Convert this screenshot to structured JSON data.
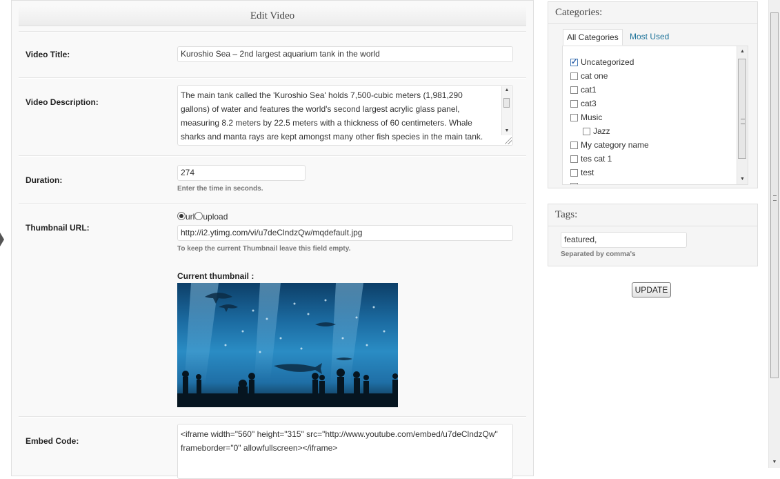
{
  "form": {
    "title": "Edit Video",
    "video_title": {
      "label": "Video Title:",
      "value": "Kuroshio Sea – 2nd largest aquarium tank in the world"
    },
    "video_description": {
      "label": "Video Description:",
      "lines": [
        "The main tank called the 'Kuroshio Sea' holds 7,500-cubic meters (1,981,290",
        "gallons) of water and features the world's second largest acrylic glass panel,",
        "measuring 8.2 meters by 22.5 meters with a thickness of 60 centimeters. Whale",
        "sharks and manta rays are kept amongst many other fish species in the main tank."
      ]
    },
    "duration": {
      "label": "Duration:",
      "value": "274",
      "hint": "Enter the time in seconds."
    },
    "thumbnail": {
      "label": "Thumbnail URL:",
      "options": [
        "url",
        "upload"
      ],
      "selected": "url",
      "value": "http://i2.ytimg.com/vi/u7deClndzQw/mqdefault.jpg",
      "hint": "To keep the current Thumbnail leave this field empty.",
      "current_label": "Current thumbnail :"
    },
    "embed_code": {
      "label": "Embed Code:",
      "lines": [
        "<iframe width=\"560\" height=\"315\" src=\"http://www.youtube.com/embed/u7deClndzQw\"",
        "frameborder=\"0\" allowfullscreen></iframe>"
      ]
    }
  },
  "categories": {
    "title": "Categories:",
    "tabs": [
      "All Categories",
      "Most Used"
    ],
    "items": [
      {
        "label": "Uncategorized",
        "checked": true,
        "child": false
      },
      {
        "label": "cat one",
        "checked": false,
        "child": false
      },
      {
        "label": "cat1",
        "checked": false,
        "child": false
      },
      {
        "label": "cat3",
        "checked": false,
        "child": false
      },
      {
        "label": "Music",
        "checked": false,
        "child": false
      },
      {
        "label": "Jazz",
        "checked": false,
        "child": true
      },
      {
        "label": "My category name",
        "checked": false,
        "child": false
      },
      {
        "label": "tes cat 1",
        "checked": false,
        "child": false
      },
      {
        "label": "test",
        "checked": false,
        "child": false
      }
    ]
  },
  "tags": {
    "title": "Tags:",
    "value": "featured,",
    "hint": "Separated by comma's"
  },
  "update_label": "UPDATE",
  "icons": {
    "scroll_up": "scroll-up-arrow-icon",
    "scroll_down": "scroll-down-arrow-icon",
    "resize": "resize-grip-icon",
    "checkmark": "checkmark-icon",
    "collapse": "collapse-arrow-icon"
  }
}
